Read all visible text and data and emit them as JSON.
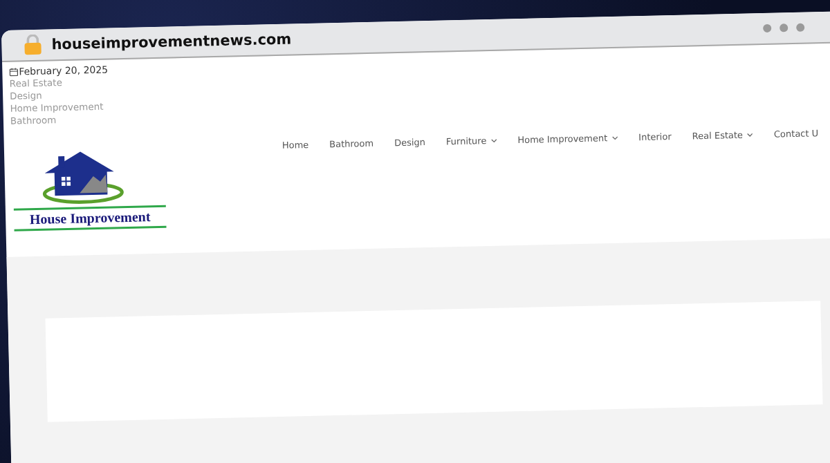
{
  "address_bar": {
    "url": "houseimprovementnews.com"
  },
  "top_bar": {
    "date": "February 20, 2025",
    "categories": [
      "Real Estate",
      "Design",
      "Home Improvement",
      "Bathroom"
    ]
  },
  "logo": {
    "text": "House Improvement"
  },
  "nav": [
    {
      "label": "Home",
      "has_menu": false
    },
    {
      "label": "Bathroom",
      "has_menu": false
    },
    {
      "label": "Design",
      "has_menu": false
    },
    {
      "label": "Furniture",
      "has_menu": true
    },
    {
      "label": "Home Improvement",
      "has_menu": true
    },
    {
      "label": "Interior",
      "has_menu": false
    },
    {
      "label": "Real Estate",
      "has_menu": true
    },
    {
      "label": "Contact U",
      "has_menu": false
    }
  ]
}
